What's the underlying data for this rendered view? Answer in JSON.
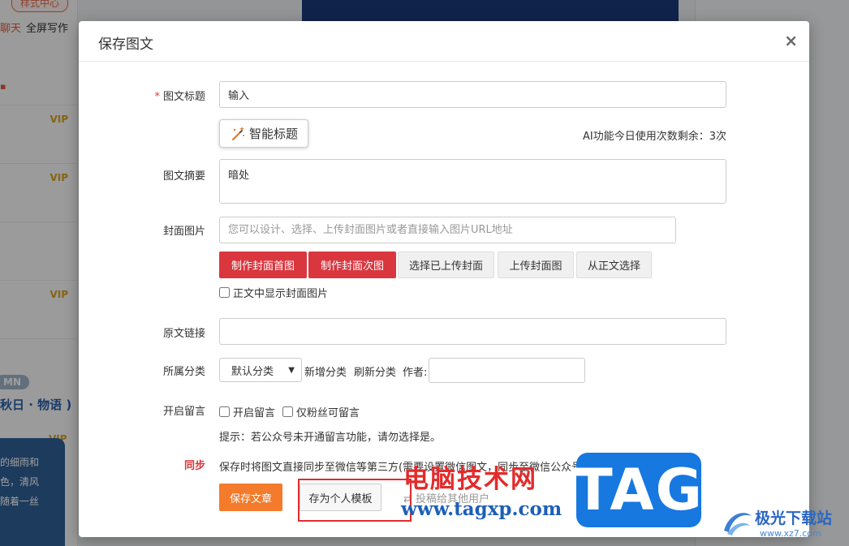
{
  "background": {
    "tag": "样式中心",
    "menu": [
      "聊天",
      "全屏写作"
    ],
    "vip_badges": [
      "VIP",
      "VIP",
      "VIP",
      "VIP"
    ],
    "pill": "MN",
    "article_title": "秋日 · 物语 )",
    "card_lines": [
      "的细雨和",
      "色，清风",
      "随着一丝"
    ]
  },
  "modal": {
    "title": "保存图文",
    "close_icon": "×",
    "fields": {
      "title_label": "图文标题",
      "title_required": "*",
      "title_value": "输入",
      "ai_title_button": "智能标题",
      "ai_count_text": "AI功能今日使用次数剩余：3次",
      "summary_label": "图文摘要",
      "summary_value": "暗处",
      "cover_label": "封面图片",
      "cover_placeholder": "您可以设计、选择、上传封面图片或者直接输入图片URL地址",
      "cover_buttons": [
        "制作封面首图",
        "制作封面次图",
        "选择已上传封面",
        "上传封面图",
        "从正文选择"
      ],
      "show_cover_checkbox": "正文中显示封面图片",
      "source_label": "原文链接",
      "source_value": "",
      "category_label": "所属分类",
      "category_selected": "默认分类",
      "add_category": "新增分类",
      "refresh_category": "刷新分类",
      "author_label": "作者:",
      "author_value": "",
      "comment_label": "开启留言",
      "comment_checkbox": "开启留言",
      "fans_only_checkbox": "仅粉丝可留言",
      "comment_hint": "提示：若公众号未开通留言功能，请勿选择是。",
      "sync_label": "同步",
      "sync_text": "保存时将图文直接同步至微信等第三方(需要设置微信图文，同步至微信公众号)"
    },
    "footer": {
      "save_button": "保存文章",
      "template_button": "存为个人模板",
      "share_link": "⇄ 投稿给其他用户"
    }
  },
  "watermarks": {
    "site_name": "电脑技术网",
    "site_url": "www.tagxp.com",
    "tag_logo": "TAG",
    "logo2_name": "极光下载站",
    "logo2_url": "www.xz7.com"
  },
  "colors": {
    "primary_red": "#d9363e",
    "orange": "#f37b2b",
    "watermark_blue": "#1778e0",
    "watermark_red": "#e32b2b"
  }
}
